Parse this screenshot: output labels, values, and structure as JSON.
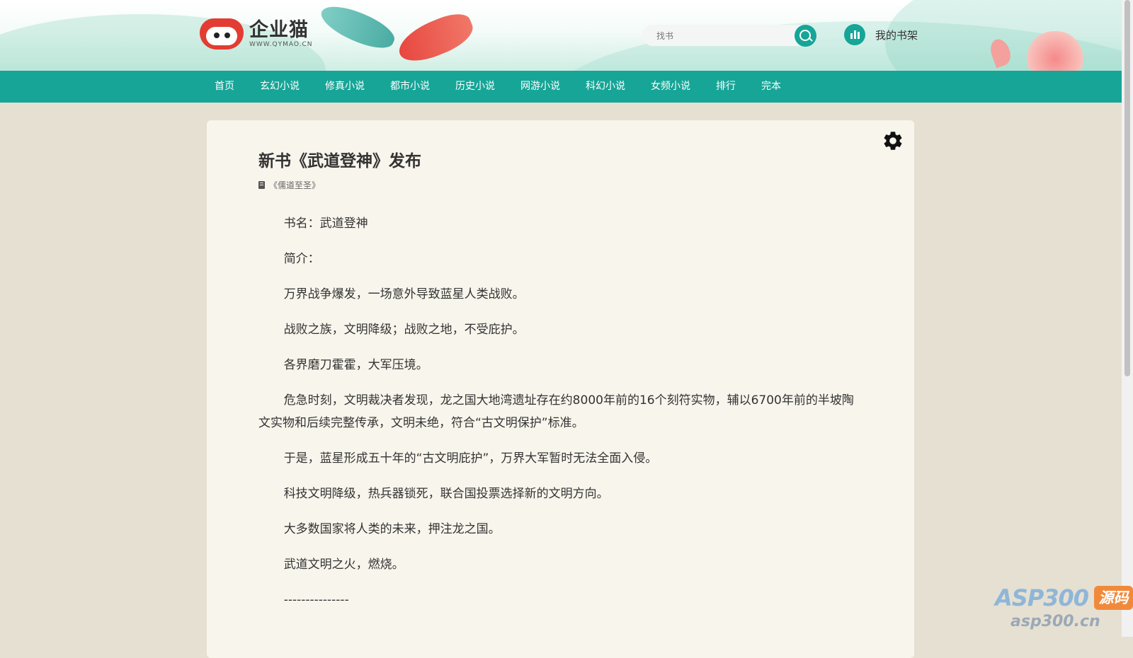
{
  "header": {
    "logo": {
      "name": "企业猫",
      "domain": "WWW.QYMAO.CN"
    },
    "search": {
      "placeholder": "找书",
      "value": ""
    },
    "shelf_label": "我的书架"
  },
  "nav": {
    "items": [
      "首页",
      "玄幻小说",
      "修真小说",
      "都市小说",
      "历史小说",
      "网游小说",
      "科幻小说",
      "女频小说",
      "排行",
      "完本"
    ]
  },
  "article": {
    "title": "新书《武道登神》发布",
    "book_link": "《儒道至圣》",
    "paragraphs": [
      "书名：武道登神",
      "简介：",
      "万界战争爆发，一场意外导致蓝星人类战败。",
      "战败之族，文明降级；战败之地，不受庇护。",
      "各界磨刀霍霍，大军压境。",
      "危急时刻，文明裁决者发现，龙之国大地湾遗址存在约8000年前的16个刻符实物，辅以6700年前的半坡陶文实物和后续完整传承，文明未绝，符合“古文明保护”标准。",
      "于是，蓝星形成五十年的“古文明庇护”，万界大军暂时无法全面入侵。",
      "科技文明降级，热兵器锁死，联合国投票选择新的文明方向。",
      "大多数国家将人类的未来，押注龙之国。",
      "武道文明之火，燃烧。",
      "---------------"
    ]
  },
  "watermark": {
    "brand": "ASP300",
    "badge": "源码",
    "url": "asp300.cn"
  },
  "colors": {
    "accent": "#16a597",
    "page_bg": "#e6e0d2",
    "card_bg": "#f8f5ec",
    "logo_red": "#e23c33"
  },
  "icons": {
    "search": "search-icon",
    "shelf": "bar-chart-icon",
    "settings": "gear-icon",
    "book": "book-icon"
  }
}
